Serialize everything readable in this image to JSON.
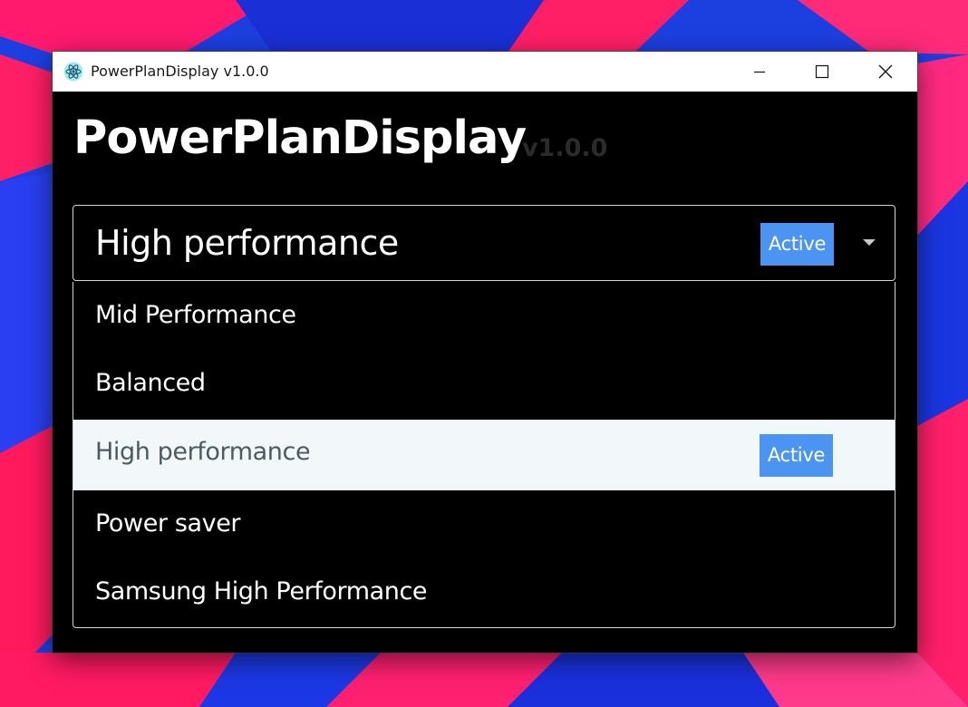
{
  "window": {
    "title": "PowerPlanDisplay v1.0.0",
    "app_icon": "electron-atom-icon"
  },
  "controls": {
    "minimize_icon": "minimize-icon",
    "maximize_icon": "maximize-icon",
    "close_icon": "close-icon"
  },
  "header": {
    "app_name": "PowerPlanDisplay",
    "version": "v1.0.0"
  },
  "select": {
    "value": "High performance",
    "badge": "Active",
    "expanded": true,
    "chevron_icon": "caret-down-icon"
  },
  "options": [
    {
      "label": "Mid Performance",
      "active": false
    },
    {
      "label": "Balanced",
      "active": false
    },
    {
      "label": "High performance",
      "active": true,
      "badge": "Active"
    },
    {
      "label": "Power saver",
      "active": false
    },
    {
      "label": "Samsung High Performance",
      "active": false
    }
  ],
  "colors": {
    "app_background": "#000000",
    "badge": "#4c94f2",
    "selected_option_background": "#f2f7f9",
    "version_text": "#2b2b2b"
  }
}
